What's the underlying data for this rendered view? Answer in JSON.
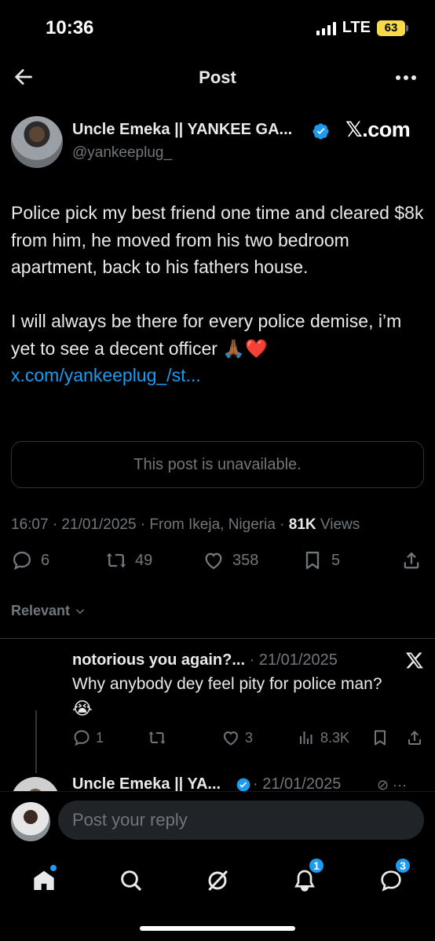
{
  "status_bar": {
    "time": "10:36",
    "network": "LTE",
    "battery": "63"
  },
  "header": {
    "title": "Post"
  },
  "post": {
    "author_name": "Uncle Emeka || YANKEE GA...",
    "handle": "@yankeeplug_",
    "source_label": "𝕏.com",
    "paragraph1": "Police pick my best friend one time and cleared $8k from him, he moved from his two bedroom apartment, back to his fathers house.",
    "paragraph2_text": "I will always be there for every police demise, i’m yet to see a decent officer 🙏🏾❤️ ",
    "paragraph2_link": "x.com/yankeeplug_/st...",
    "quoted_unavailable": "This post is unavailable.",
    "meta_prefix": "16:07 · 21/01/2025 · From Ikeja, Nigeria · ",
    "views_count": "81K",
    "views_label": " Views",
    "replies": "6",
    "reposts": "49",
    "likes": "358",
    "bookmarks": "5"
  },
  "sort": {
    "label": "Relevant"
  },
  "reply1": {
    "name": "notorious you again?...",
    "date": " · 21/01/2025",
    "text": "Why anybody dey feel pity for police man?",
    "emoji": "😭",
    "replies": "1",
    "likes": "3",
    "views": "8.3K"
  },
  "reply2": {
    "name": "Uncle Emeka || YA...",
    "date": " · 21/01/2025"
  },
  "composer": {
    "placeholder": "Post your reply"
  },
  "tabbar": {
    "notifications_badge": "1",
    "messages_badge": "3"
  },
  "colors": {
    "accent": "#1d9bf0",
    "background": "#000000",
    "muted": "#71767b"
  }
}
